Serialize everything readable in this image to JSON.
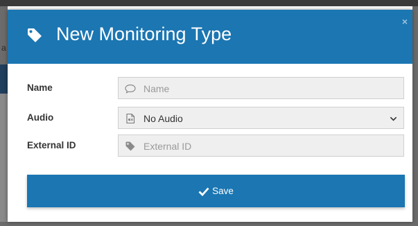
{
  "modal": {
    "title": "New Monitoring Type",
    "title_icon": "tag-icon",
    "close_label": "×"
  },
  "backdrop": {
    "ghost_letter": "a"
  },
  "form": {
    "name": {
      "label": "Name",
      "placeholder": "Name",
      "value": "",
      "icon": "comment-icon"
    },
    "audio": {
      "label": "Audio",
      "selected": "No Audio",
      "icon": "audio-file-icon"
    },
    "external_id": {
      "label": "External ID",
      "placeholder": "External ID",
      "value": "",
      "icon": "tag-icon"
    }
  },
  "actions": {
    "save_label": "Save",
    "save_icon": "check-icon"
  },
  "colors": {
    "primary": "#1b76b2",
    "field_bg": "#efefef",
    "label_text": "#333333"
  }
}
